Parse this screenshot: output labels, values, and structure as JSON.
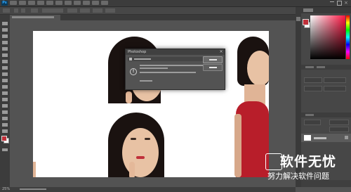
{
  "app": {
    "logo_text": "Ps"
  },
  "dialog": {
    "title": "Photoshop"
  },
  "status": {
    "zoom": "25%"
  },
  "watermark": {
    "title": "软件无忧",
    "subtitle": "努力解决软件问题"
  },
  "colors": {
    "foreground": "#c0303a",
    "background": "#ffffff",
    "accent": "#31a8ff"
  }
}
